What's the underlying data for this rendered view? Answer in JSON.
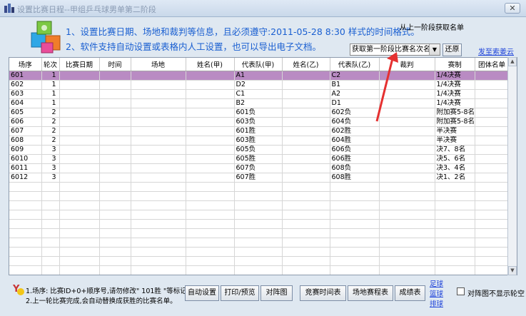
{
  "window": {
    "title": "设置比赛日程--甲组乒乓球男单第二阶段",
    "close_symbol": "✕"
  },
  "info": {
    "line1": "1、设置比赛日期、场地和裁判等信息，且必须遵守:2011-05-28  8:30 样式的时间格式。",
    "line2": "2、软件支持自动设置或表格内人工设置，也可以导出电子文档。",
    "from_previous": "从上一阶段获取名单"
  },
  "controls": {
    "select_value": "获取第一阶段比赛名次名单",
    "select_arrow": "▼",
    "restore_label": "还原",
    "feedback_link": "发至索姜云"
  },
  "table": {
    "columns": [
      "场序",
      "轮次",
      "比赛日期",
      "时间",
      "场地",
      "姓名(甲)",
      "代表队(甲)",
      "姓名(乙)",
      "代表队(乙)",
      "裁判",
      "赛制",
      "团体名单"
    ],
    "rows": [
      [
        "601",
        "1",
        "",
        "",
        "",
        "",
        "A1",
        "",
        "C2",
        "",
        "1/4决赛",
        ""
      ],
      [
        "602",
        "1",
        "",
        "",
        "",
        "",
        "D2",
        "",
        "B1",
        "",
        "1/4决赛",
        ""
      ],
      [
        "603",
        "1",
        "",
        "",
        "",
        "",
        "C1",
        "",
        "A2",
        "",
        "1/4决赛",
        ""
      ],
      [
        "604",
        "1",
        "",
        "",
        "",
        "",
        "B2",
        "",
        "D1",
        "",
        "1/4决赛",
        ""
      ],
      [
        "605",
        "2",
        "",
        "",
        "",
        "",
        "601负",
        "",
        "602负",
        "",
        "附加赛5-8名",
        ""
      ],
      [
        "606",
        "2",
        "",
        "",
        "",
        "",
        "603负",
        "",
        "604负",
        "",
        "附加赛5-8名",
        ""
      ],
      [
        "607",
        "2",
        "",
        "",
        "",
        "",
        "601胜",
        "",
        "602胜",
        "",
        "半决赛",
        ""
      ],
      [
        "608",
        "2",
        "",
        "",
        "",
        "",
        "603胜",
        "",
        "604胜",
        "",
        "半决赛",
        ""
      ],
      [
        "609",
        "3",
        "",
        "",
        "",
        "",
        "605负",
        "",
        "606负",
        "",
        "决7、8名",
        ""
      ],
      [
        "6010",
        "3",
        "",
        "",
        "",
        "",
        "605胜",
        "",
        "606胜",
        "",
        "决5、6名",
        ""
      ],
      [
        "6011",
        "3",
        "",
        "",
        "",
        "",
        "607负",
        "",
        "608负",
        "",
        "决3、4名",
        ""
      ],
      [
        "6012",
        "3",
        "",
        "",
        "",
        "",
        "607胜",
        "",
        "608胜",
        "",
        "决1、2名",
        ""
      ]
    ],
    "selected_row": 0
  },
  "scroll": {
    "up": "▲",
    "down": "▼"
  },
  "notes": {
    "logo": "Y",
    "note1": "1.场序: 比赛ID+0+顺序号,请勿修改\" 101胜 \"等标记。",
    "note2": "2.上一轮比赛完成,会自动替换成获胜的比赛名单。"
  },
  "buttons": {
    "auto": "自动设置",
    "print": "打印/预览",
    "draw": "对阵图",
    "time_table": "竞赛时间表",
    "venue_table": "场地赛程表",
    "results": "成绩表"
  },
  "sports_links": [
    "足球",
    "篮球",
    "排球"
  ],
  "checkbox_label": "对阵图不显示轮空",
  "colors": {
    "title_blue": "#1a5fd1",
    "selected_row": "#b98bc3",
    "arrow_red": "#e53030"
  }
}
